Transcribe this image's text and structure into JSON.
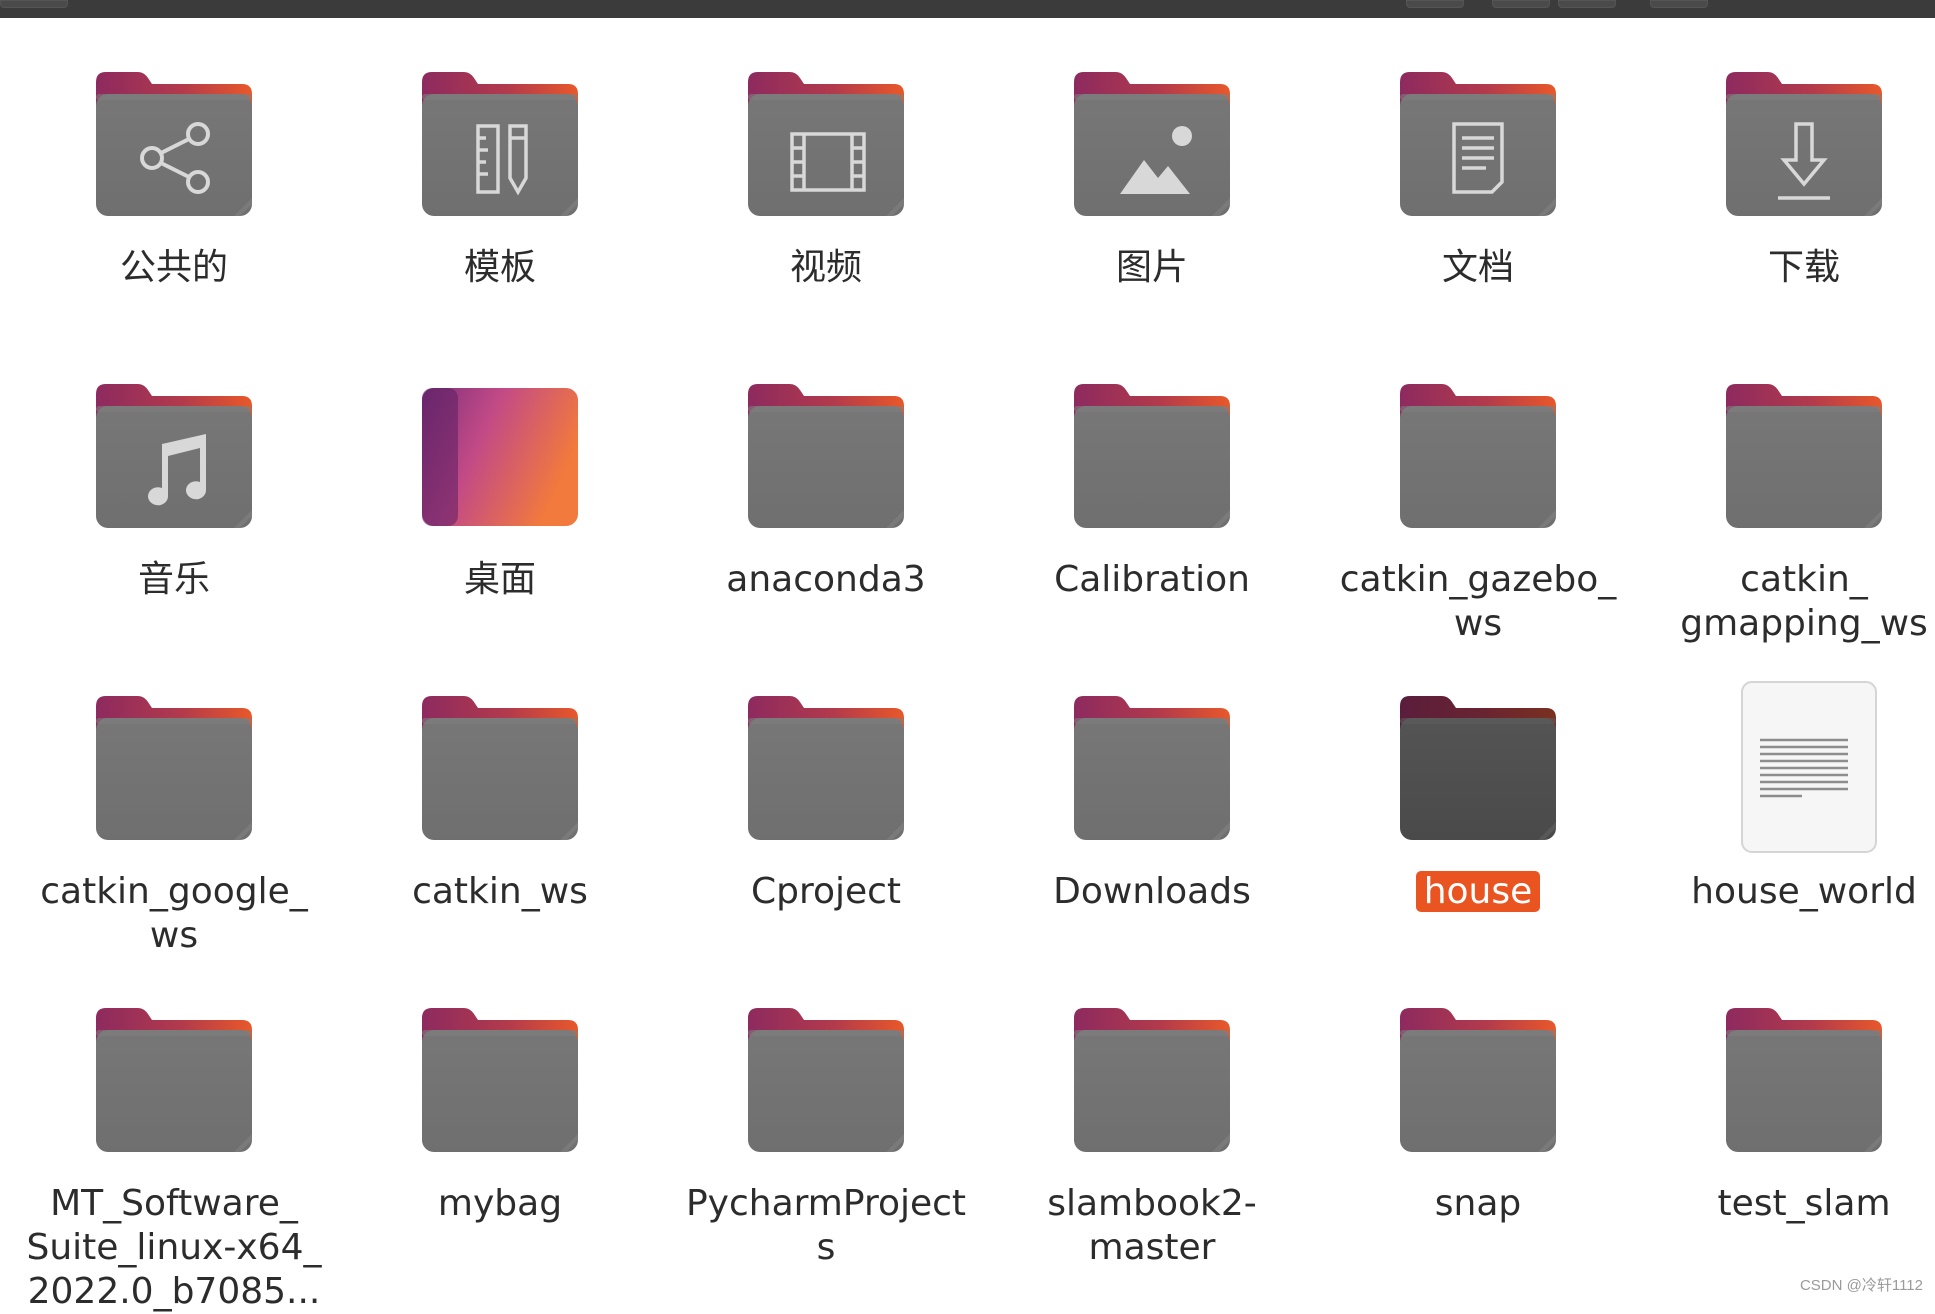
{
  "items": [
    {
      "label": "公共的",
      "icon": "share-folder-icon"
    },
    {
      "label": "模板",
      "icon": "templates-folder-icon"
    },
    {
      "label": "视频",
      "icon": "videos-folder-icon"
    },
    {
      "label": "图片",
      "icon": "pictures-folder-icon"
    },
    {
      "label": "文档",
      "icon": "documents-folder-icon"
    },
    {
      "label": "下载",
      "icon": "downloads-folder-icon"
    },
    {
      "label": "音乐",
      "icon": "music-folder-icon"
    },
    {
      "label": "桌面",
      "icon": "desktop-folder-icon"
    },
    {
      "label": "anaconda3",
      "icon": "folder-icon"
    },
    {
      "label": "Calibration",
      "icon": "folder-icon"
    },
    {
      "label": "catkin_gazebo_\nws",
      "icon": "folder-icon"
    },
    {
      "label": "catkin_\ngmapping_ws",
      "icon": "folder-icon"
    },
    {
      "label": "catkin_google_\nws",
      "icon": "folder-icon"
    },
    {
      "label": "catkin_ws",
      "icon": "folder-icon"
    },
    {
      "label": "Cproject",
      "icon": "folder-icon"
    },
    {
      "label": "Downloads",
      "icon": "folder-icon"
    },
    {
      "label": "house",
      "icon": "folder-selected-icon",
      "selected": true
    },
    {
      "label": "house_world",
      "icon": "text-file-icon"
    },
    {
      "label": "MT_Software_\nSuite_linux-x64_\n2022.0_b7085...",
      "icon": "folder-icon"
    },
    {
      "label": "mybag",
      "icon": "folder-icon"
    },
    {
      "label": "PycharmProject\ns",
      "icon": "folder-icon"
    },
    {
      "label": "slambook2-\nmaster",
      "icon": "folder-icon"
    },
    {
      "label": "snap",
      "icon": "folder-icon"
    },
    {
      "label": "test_slam",
      "icon": "folder-icon"
    }
  ],
  "watermark": "CSDN @冷轩1112",
  "colors": {
    "folder_body": "#6d6d6d",
    "folder_tab_start": "#8a2a5c",
    "folder_tab_end": "#e95420",
    "selection": "#e95420"
  }
}
